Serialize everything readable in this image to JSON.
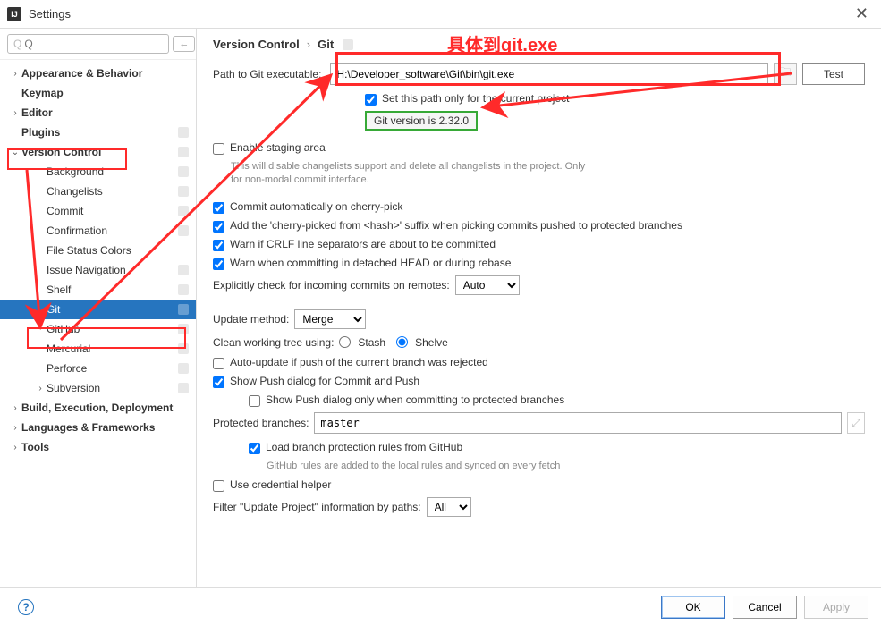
{
  "window": {
    "title": "Settings"
  },
  "search": {
    "placeholder": "Q"
  },
  "sidebar": {
    "items": [
      {
        "label": "Appearance & Behavior",
        "bold": true,
        "chev": "›",
        "indent": 0
      },
      {
        "label": "Keymap",
        "bold": true,
        "chev": "",
        "indent": 0
      },
      {
        "label": "Editor",
        "bold": true,
        "chev": "›",
        "indent": 0
      },
      {
        "label": "Plugins",
        "bold": true,
        "chev": "",
        "indent": 0,
        "badge": true
      },
      {
        "label": "Version Control",
        "bold": true,
        "chev": "⌄",
        "indent": 0,
        "badge": true
      },
      {
        "label": "Background",
        "bold": false,
        "chev": "",
        "indent": 2,
        "badge": true
      },
      {
        "label": "Changelists",
        "bold": false,
        "chev": "",
        "indent": 2,
        "badge": true
      },
      {
        "label": "Commit",
        "bold": false,
        "chev": "",
        "indent": 2,
        "badge": true
      },
      {
        "label": "Confirmation",
        "bold": false,
        "chev": "",
        "indent": 2,
        "badge": true
      },
      {
        "label": "File Status Colors",
        "bold": false,
        "chev": "",
        "indent": 2
      },
      {
        "label": "Issue Navigation",
        "bold": false,
        "chev": "",
        "indent": 2,
        "badge": true
      },
      {
        "label": "Shelf",
        "bold": false,
        "chev": "",
        "indent": 2,
        "badge": true
      },
      {
        "label": "Git",
        "bold": false,
        "chev": "",
        "indent": 2,
        "badge": true,
        "selected": true
      },
      {
        "label": "GitHub",
        "bold": false,
        "chev": "",
        "indent": 2,
        "badge": true
      },
      {
        "label": "Mercurial",
        "bold": false,
        "chev": "",
        "indent": 2,
        "badge": true
      },
      {
        "label": "Perforce",
        "bold": false,
        "chev": "",
        "indent": 2,
        "badge": true
      },
      {
        "label": "Subversion",
        "bold": false,
        "chev": "›",
        "indent": 2,
        "badge": true
      },
      {
        "label": "Build, Execution, Deployment",
        "bold": true,
        "chev": "›",
        "indent": 0
      },
      {
        "label": "Languages & Frameworks",
        "bold": true,
        "chev": "›",
        "indent": 0
      },
      {
        "label": "Tools",
        "bold": true,
        "chev": "›",
        "indent": 0
      }
    ]
  },
  "breadcrumb": {
    "a": "Version Control",
    "sep": "›",
    "b": "Git"
  },
  "fields": {
    "path_label": "Path to Git executable:",
    "path_value": "H:\\Developer_software\\Git\\bin\\git.exe",
    "test_label": "Test",
    "set_current": "Set this path only for the current project",
    "version": "Git version is 2.32.0",
    "enable_staging": "Enable staging area",
    "staging_hint": "This will disable changelists support and delete all changelists in the project. Only for non-modal commit interface.",
    "cherry_auto": "Commit automatically on cherry-pick",
    "cherry_suffix": "Add the 'cherry-picked from <hash>' suffix when picking commits pushed to protected branches",
    "crlf_warn": "Warn if CRLF line separators are about to be committed",
    "detached_warn": "Warn when committing in detached HEAD or during rebase",
    "explicit_label": "Explicitly check for incoming commits on remotes:",
    "explicit_value": "Auto",
    "update_label": "Update method:",
    "update_value": "Merge",
    "clean_label": "Clean working tree using:",
    "clean_stash": "Stash",
    "clean_shelve": "Shelve",
    "auto_update": "Auto-update if push of the current branch was rejected",
    "show_push": "Show Push dialog for Commit and Push",
    "show_push_protected": "Show Push dialog only when committing to protected branches",
    "protected_label": "Protected branches:",
    "protected_value": "master",
    "load_branch": "Load branch protection rules from GitHub",
    "load_hint": "GitHub rules are added to the local rules and synced on every fetch",
    "cred_helper": "Use credential helper",
    "filter_label": "Filter \"Update Project\" information by paths:",
    "filter_value": "All"
  },
  "footer": {
    "ok": "OK",
    "cancel": "Cancel",
    "apply": "Apply"
  },
  "annotations": {
    "title_cn": "具体到git.exe"
  }
}
